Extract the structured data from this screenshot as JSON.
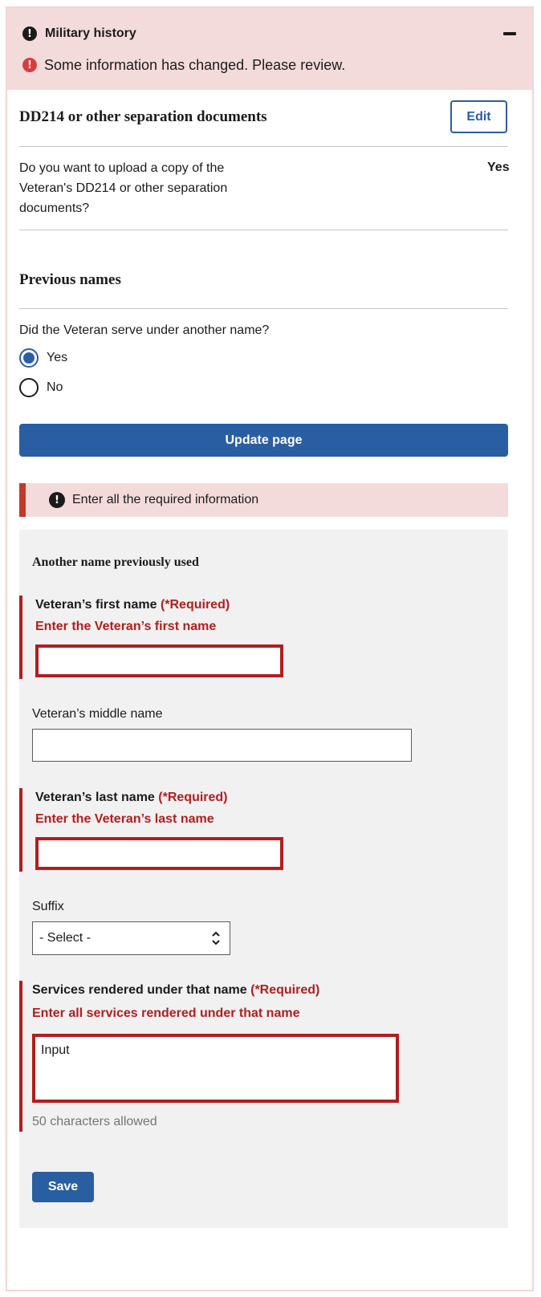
{
  "header": {
    "title": "Military history",
    "title_icon": "exclamation-circle-icon",
    "collapse_icon": "minus-icon",
    "change_message": "Some information has changed. Please review."
  },
  "dd214_section": {
    "title": "DD214 or other separation documents",
    "edit_label": "Edit",
    "question": "Do you want to upload a copy of the Veteran's DD214 or other separation documents?",
    "answer": "Yes"
  },
  "previous_names": {
    "title": "Previous names",
    "question": "Did the Veteran serve under another name?",
    "options": [
      {
        "label": "Yes",
        "selected": true
      },
      {
        "label": "No",
        "selected": false
      }
    ],
    "update_label": "Update page"
  },
  "alert": {
    "message": "Enter all the required information"
  },
  "form": {
    "title": "Another name previously used",
    "required_tag": "(*Required)",
    "first_name": {
      "label": "Veteran’s first name",
      "error": "Enter the Veteran’s first name",
      "value": ""
    },
    "middle_name": {
      "label": "Veteran’s middle name",
      "value": ""
    },
    "last_name": {
      "label": "Veteran’s last name",
      "error": "Enter the Veteran’s last name",
      "value": ""
    },
    "suffix": {
      "label": "Suffix",
      "selected": "- Select -"
    },
    "services": {
      "label": "Services rendered under that name",
      "error": "Enter all services rendered under that name",
      "value": "Input",
      "hint": "50 characters allowed"
    },
    "save_label": "Save"
  },
  "colors": {
    "primary": "#2a5ea2",
    "error": "#b31d1d",
    "alert_bg": "#f4dbdb",
    "panel_bg": "#f1f1f1"
  }
}
